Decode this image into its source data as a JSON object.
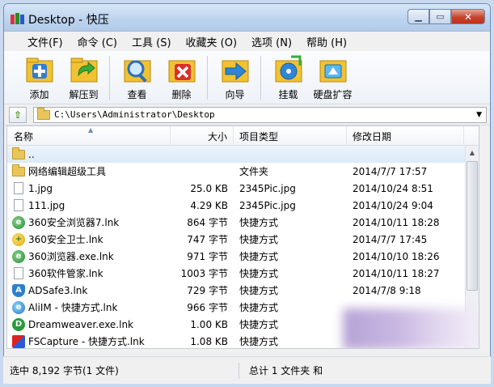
{
  "window": {
    "title": "Desktop - 快压"
  },
  "menu": [
    "文件(F)",
    "命令 (C)",
    "工具 (S)",
    "收藏夹 (O)",
    "选项 (N)",
    "帮助 (H)"
  ],
  "toolbar": [
    {
      "label": "添加",
      "icon": "add-icon"
    },
    {
      "label": "解压到",
      "icon": "extract-icon"
    },
    {
      "label": "查看",
      "icon": "view-icon"
    },
    {
      "label": "删除",
      "icon": "delete-icon"
    },
    {
      "label": "向导",
      "icon": "wizard-icon"
    },
    {
      "label": "挂载",
      "icon": "mount-icon"
    },
    {
      "label": "硬盘扩容",
      "icon": "disk-expand-icon"
    }
  ],
  "address": {
    "path": "C:\\Users\\Administrator\\Desktop"
  },
  "columns": {
    "name": "名称",
    "size": "大小",
    "type": "项目类型",
    "date": "修改日期"
  },
  "files": [
    {
      "name": "..",
      "size": "",
      "type": "",
      "date": "",
      "icon": "folder"
    },
    {
      "name": "网络编辑超级工具",
      "size": "",
      "type": "文件夹",
      "date": "2014/7/7 17:57",
      "icon": "folder"
    },
    {
      "name": "1.jpg",
      "size": "25.0 KB",
      "type": "2345Pic.jpg",
      "date": "2014/10/24 8:51",
      "icon": "doc"
    },
    {
      "name": "111.jpg",
      "size": "4.29 KB",
      "type": "2345Pic.jpg",
      "date": "2014/10/24 9:04",
      "icon": "doc"
    },
    {
      "name": "360安全浏览器7.lnk",
      "size": "864 字节",
      "type": "快捷方式",
      "date": "2014/10/11 18:28",
      "icon": "ie"
    },
    {
      "name": "360安全卫士.lnk",
      "size": "747 字节",
      "type": "快捷方式",
      "date": "2014/7/7 17:45",
      "icon": "shield"
    },
    {
      "name": "360浏览器.exe.lnk",
      "size": "971 字节",
      "type": "快捷方式",
      "date": "2014/10/10 18:26",
      "icon": "ie"
    },
    {
      "name": "360软件管家.lnk",
      "size": "1003 字节",
      "type": "快捷方式",
      "date": "2014/10/11 18:27",
      "icon": "doc"
    },
    {
      "name": "ADSafe3.lnk",
      "size": "729 字节",
      "type": "快捷方式",
      "date": "2014/7/8 9:18",
      "icon": "adsafe"
    },
    {
      "name": "AliIM - 快捷方式.lnk",
      "size": "966 字节",
      "type": "快捷方式",
      "date": "",
      "icon": "ali"
    },
    {
      "name": "Dreamweaver.exe.lnk",
      "size": "1.00 KB",
      "type": "快捷方式",
      "date": "",
      "icon": "dw"
    },
    {
      "name": "FSCapture - 快捷方式.lnk",
      "size": "1.08 KB",
      "type": "快捷方式",
      "date": "",
      "icon": "fsc"
    }
  ],
  "status": {
    "left": "选中 8,192 字节(1 文件)",
    "right": "总计 1 文件夹 和"
  }
}
